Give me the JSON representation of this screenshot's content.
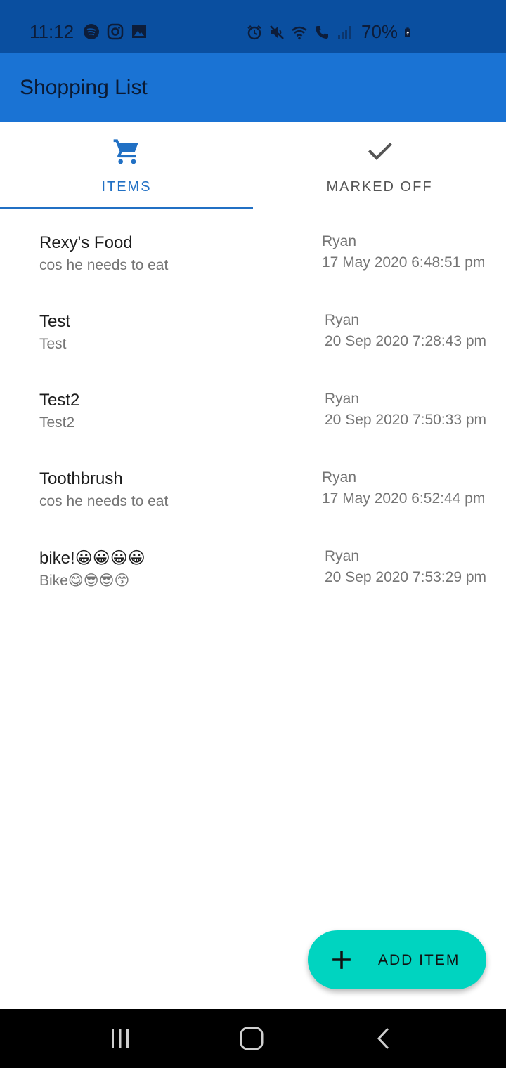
{
  "status_bar": {
    "time": "11:12",
    "battery": "70%",
    "left_icons": [
      "spotify-icon",
      "instagram-icon",
      "gallery-icon"
    ],
    "right_icons": [
      "alarm-icon",
      "mute-icon",
      "wifi-icon",
      "wifi-call-icon",
      "signal-icon",
      "battery-icon"
    ]
  },
  "app_bar": {
    "title": "Shopping List"
  },
  "tabs": [
    {
      "label": "ITEMS",
      "icon": "cart-icon",
      "selected": true
    },
    {
      "label": "MARKED OFF",
      "icon": "check-icon",
      "selected": false
    }
  ],
  "items": [
    {
      "name": "Rexy's Food",
      "description": "cos he needs to eat",
      "user": "Ryan",
      "date": "17 May 2020 6:48:51 pm"
    },
    {
      "name": "Test",
      "description": "Test",
      "user": "Ryan",
      "date": "20 Sep 2020 7:28:43 pm"
    },
    {
      "name": "Test2",
      "description": "Test2",
      "user": "Ryan",
      "date": "20 Sep 2020 7:50:33 pm"
    },
    {
      "name": "Toothbrush",
      "description": "cos he needs to eat",
      "user": "Ryan",
      "date": "17 May 2020 6:52:44 pm"
    },
    {
      "name": "bike!😀😀😀😀",
      "description": "Bike😋😎😎😙",
      "user": "Ryan",
      "date": "20 Sep 2020 7:53:29 pm"
    }
  ],
  "fab": {
    "label": "ADD ITEM",
    "icon": "plus-icon"
  },
  "nav_bar": {
    "buttons": [
      "recents-icon",
      "home-icon",
      "back-icon"
    ]
  },
  "colors": {
    "status_bar": "#0a4fa0",
    "app_bar": "#1a73d4",
    "accent": "#2170c4",
    "fab": "#00d4c0"
  }
}
